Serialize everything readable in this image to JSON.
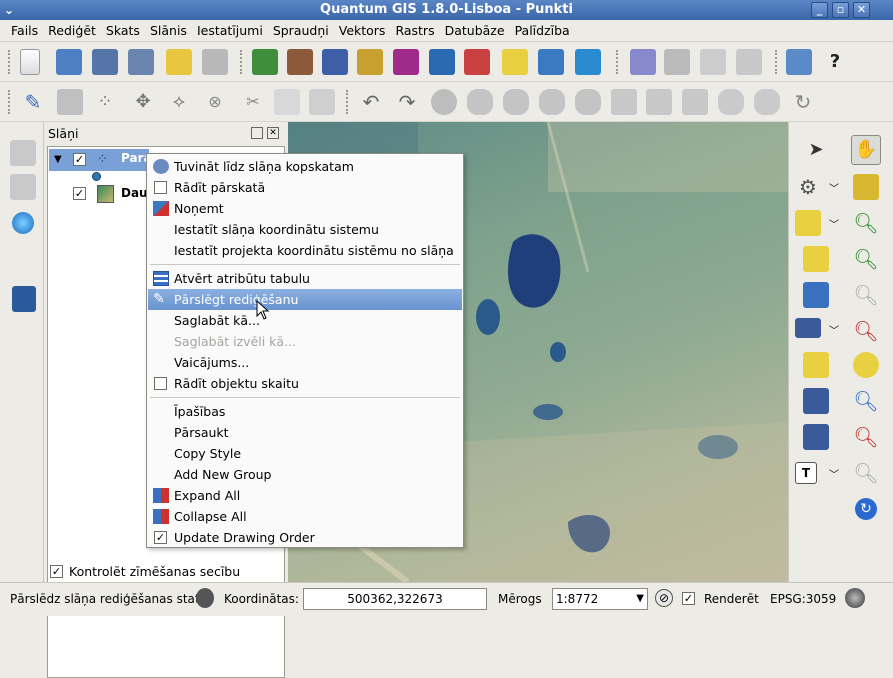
{
  "window": {
    "title": "Quantum GIS 1.8.0-Lisboa - Punkti"
  },
  "menubar": [
    "Fails",
    "Rediģēt",
    "Skats",
    "Slānis",
    "Iestatījumi",
    "Spraudņi",
    "Vektors",
    "Rastrs",
    "Datubāze",
    "Palīdzība"
  ],
  "layers_panel": {
    "title": "Slāņi",
    "layers": [
      {
        "name": "Para",
        "checked": true,
        "selected": true
      },
      {
        "name": "Daug",
        "checked": true,
        "selected": false
      }
    ],
    "render_order_label": "Kontrolēt zīmēšanas secību"
  },
  "context_menu": {
    "items": [
      {
        "label": "Tuvināt līdz slāņa kopskatam",
        "icon": "zoom-layer-icon"
      },
      {
        "label": "Rādīt pārskatā",
        "check": false
      },
      {
        "label": "Noņemt",
        "icon": "remove-layer-icon"
      },
      {
        "label": "Iestatīt slāņa koordinātu sistemu"
      },
      {
        "label": "Iestatīt projekta koordinātu sistēmu no slāņa"
      },
      {
        "label": "Atvērt atribūtu tabulu",
        "icon": "attribute-table-icon"
      },
      {
        "label": "Pārslēgt rediģēšanu",
        "icon": "pencil-icon",
        "highlighted": true
      },
      {
        "label": "Saglabāt kā..."
      },
      {
        "label": "Saglabāt izvēli kā...",
        "disabled": true
      },
      {
        "label": "Vaicājums..."
      },
      {
        "label": "Rādīt objektu skaitu",
        "check": false
      },
      {
        "label": "Īpašības"
      },
      {
        "label": "Pārsaukt"
      },
      {
        "label": "Copy Style"
      },
      {
        "label": "Add New Group"
      },
      {
        "label": "Expand All",
        "icon": "expand-icon"
      },
      {
        "label": "Collapse All",
        "icon": "collapse-icon"
      },
      {
        "label": "Update Drawing Order",
        "check": true
      }
    ]
  },
  "statusbar": {
    "message": "Pārslēdz slāņa rediģēšanas statu",
    "coords_label": "Koordinātas:",
    "coords_value": "500362,322673",
    "scale_label": "Mērogs",
    "scale_value": "1:8772",
    "render_label": "Renderēt",
    "render_checked": true,
    "crs": "EPSG:3059"
  },
  "colors": {
    "title_bg": "#4a76b8",
    "highlight": "#7aa0d8"
  }
}
